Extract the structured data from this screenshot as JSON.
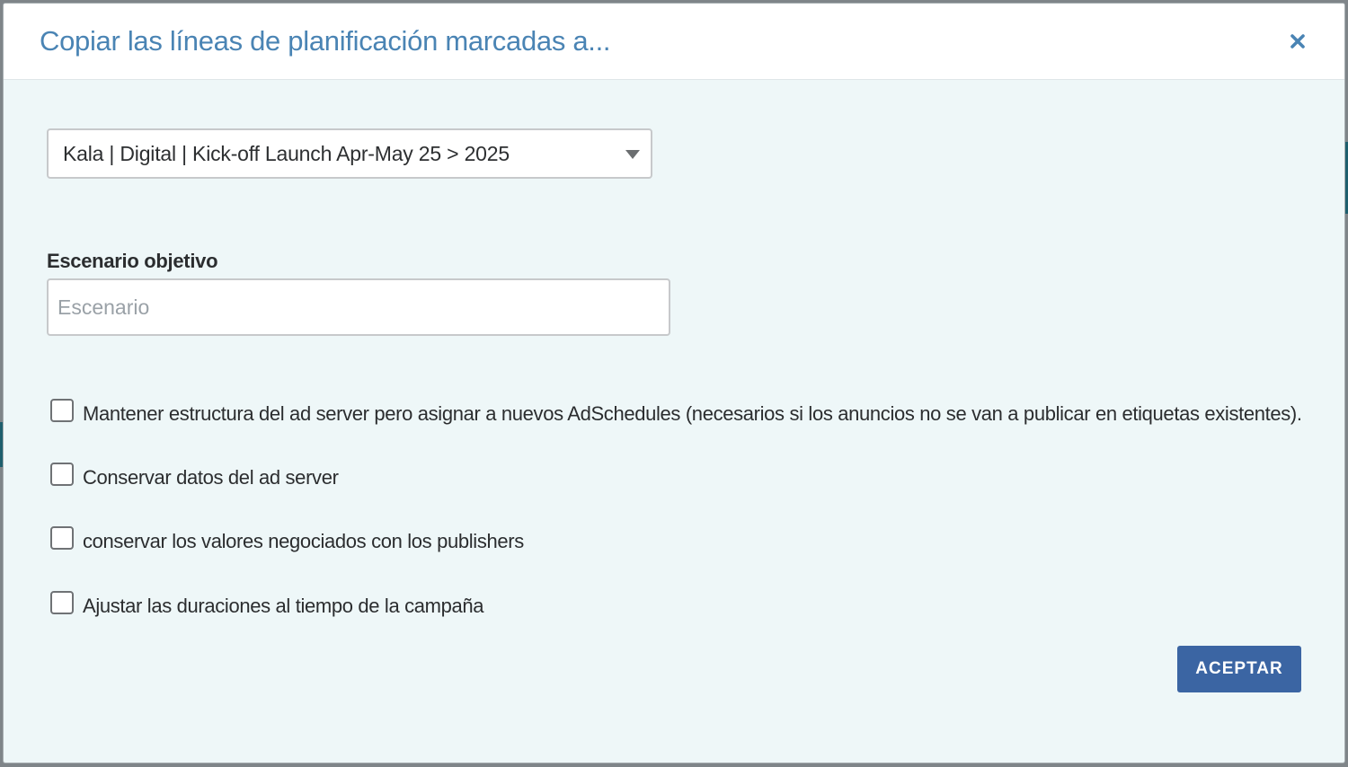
{
  "dialog": {
    "title": "Copiar las líneas de planificación marcadas a...",
    "close_icon": "close-icon"
  },
  "campaign_select": {
    "selected_value": "Kala | Digital | Kick-off Launch Apr-May 25 > 2025",
    "arrow_icon": "caret-down-icon"
  },
  "scenario": {
    "label": "Escenario objetivo",
    "placeholder": "Escenario",
    "value": ""
  },
  "options": [
    {
      "label": "Mantener estructura del ad server pero asignar a nuevos AdSchedules (necesarios si los anuncios no se van a publicar en etiquetas existentes).",
      "checked": false
    },
    {
      "label": "Conservar datos del ad server",
      "checked": false
    },
    {
      "label": "conservar los valores negociados con los publishers",
      "checked": false
    },
    {
      "label": "Ajustar las duraciones al tiempo de la campaña",
      "checked": false
    }
  ],
  "actions": {
    "accept_label": "ACEPTAR"
  },
  "colors": {
    "title": "#4a84b4",
    "accent_button": "#3b65a3",
    "body_background": "#eef7f8"
  }
}
